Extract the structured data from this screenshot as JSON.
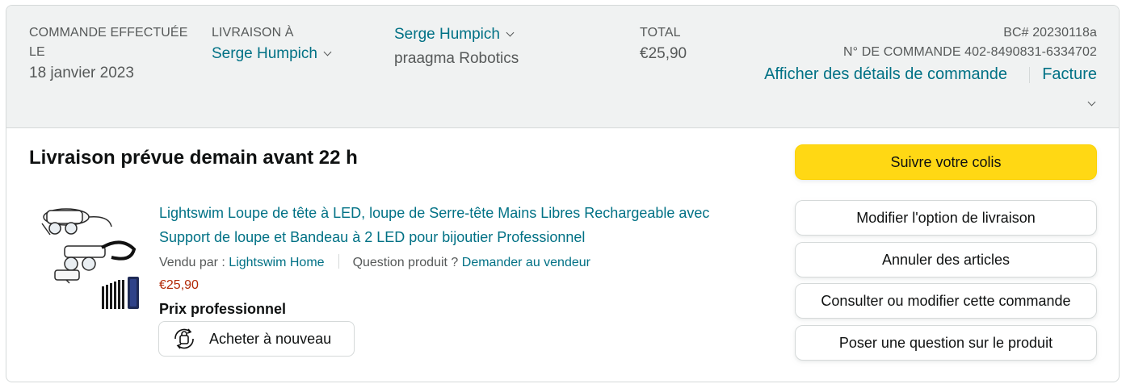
{
  "header": {
    "order_placed_label": "COMMANDE EFFECTUÉE LE",
    "order_date": "18 janvier 2023",
    "ship_to_label": "LIVRAISON À",
    "ship_to_name": "Serge Humpich",
    "recipient_name": "Serge Humpich",
    "recipient_company": "praagma Robotics",
    "total_label": "TOTAL",
    "total_value": "€25,90",
    "po_number": "BC# 20230118a",
    "order_number": "N° DE COMMANDE 402-8490831-6334702",
    "order_details_link": "Afficher des détails de commande",
    "invoice_link": "Facture"
  },
  "shipment": {
    "status_title": "Livraison prévue demain avant 22 h"
  },
  "product": {
    "title_line1": "Lightswim Loupe de tête à LED, loupe de Serre-tête Mains Libres Rechargeable avec",
    "title_line2": "Support de loupe et Bandeau à 2 LED pour bijoutier Professionnel",
    "sold_by_label": "Vendu par :",
    "seller": "Lightswim Home",
    "question_label": "Question produit ?",
    "ask_seller_link": "Demander au vendeur",
    "price": "€25,90",
    "business_price": "Prix professionnel",
    "buy_again_label": "Acheter à nouveau"
  },
  "actions": {
    "track_package": "Suivre votre colis",
    "change_delivery": "Modifier l'option de livraison",
    "cancel_items": "Annuler des articles",
    "view_edit_order": "Consulter ou modifier cette commande",
    "ask_product_question": "Poser une question sur le produit"
  },
  "colors": {
    "link": "#007185",
    "price": "#b12704",
    "primary_button": "#ffd814",
    "header_bg": "#f0f2f2"
  },
  "icons": {
    "chevron": "chevron-down-icon",
    "rebuy": "buy-again-icon"
  }
}
